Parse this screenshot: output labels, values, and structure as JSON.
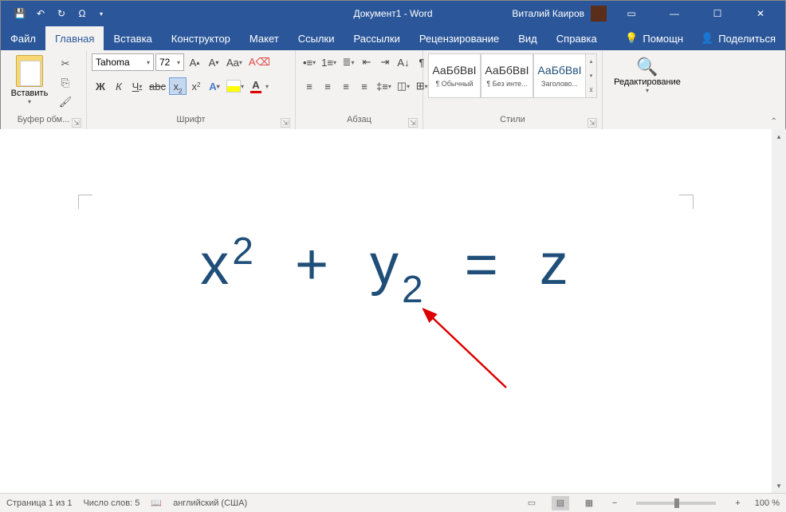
{
  "titlebar": {
    "doc_title": "Документ1 - Word",
    "user_name": "Виталий Каиров"
  },
  "tabs": {
    "file": "Файл",
    "home": "Главная",
    "insert": "Вставка",
    "design": "Конструктор",
    "layout": "Макет",
    "references": "Ссылки",
    "mailings": "Рассылки",
    "review": "Рецензирование",
    "view": "Вид",
    "help": "Справка",
    "tell_me": "Помощн",
    "share": "Поделиться"
  },
  "ribbon": {
    "clipboard": {
      "paste": "Вставить",
      "label": "Буфер обм..."
    },
    "font": {
      "name": "Tahoma",
      "size": "72",
      "bold": "Ж",
      "italic": "К",
      "underline": "Ч",
      "strike": "abc",
      "clear": "Aa",
      "label": "Шрифт"
    },
    "paragraph": {
      "label": "Абзац"
    },
    "styles": {
      "preview": "АаБбВвІ",
      "normal": "¶ Обычный",
      "nospacing": "¶ Без инте...",
      "heading1": "Заголово...",
      "label": "Стили"
    },
    "editing": {
      "label": "Редактирование"
    }
  },
  "document": {
    "x": "x",
    "two_sup": "2",
    "plus": "+",
    "y": "y",
    "two_sub": "2",
    "equals": "=",
    "z": "z"
  },
  "statusbar": {
    "page": "Страница 1 из 1",
    "words": "Число слов: 5",
    "lang": "английский (США)",
    "zoom": "100 %"
  }
}
